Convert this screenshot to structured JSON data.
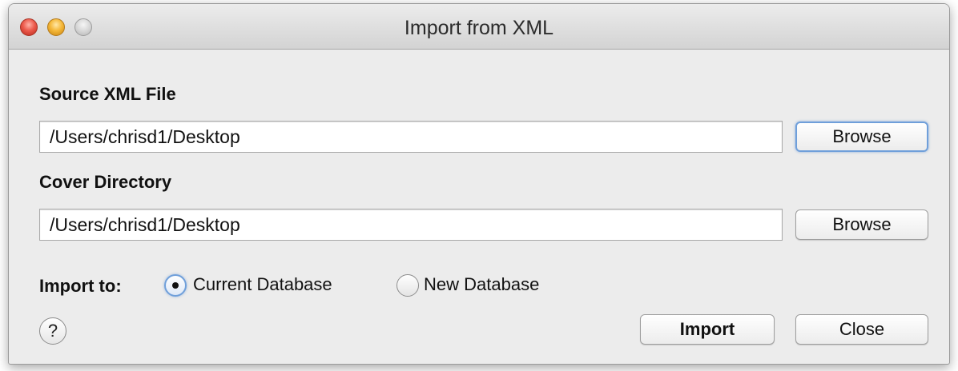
{
  "window": {
    "title": "Import from XML"
  },
  "source": {
    "label": "Source XML File",
    "value": "/Users/chrisd1/Desktop",
    "browse_label": "Browse"
  },
  "cover": {
    "label": "Cover Directory",
    "value": "/Users/chrisd1/Desktop",
    "browse_label": "Browse"
  },
  "import_to": {
    "label": "Import to:",
    "options": [
      {
        "label": "Current Database",
        "selected": true
      },
      {
        "label": "New Database",
        "selected": false
      }
    ]
  },
  "footer": {
    "help_glyph": "?",
    "import_label": "Import",
    "close_label": "Close"
  },
  "colors": {
    "focus_ring": "#6f9fda",
    "close_light": "#ec5a4c",
    "minimize_light": "#f5b83a"
  }
}
